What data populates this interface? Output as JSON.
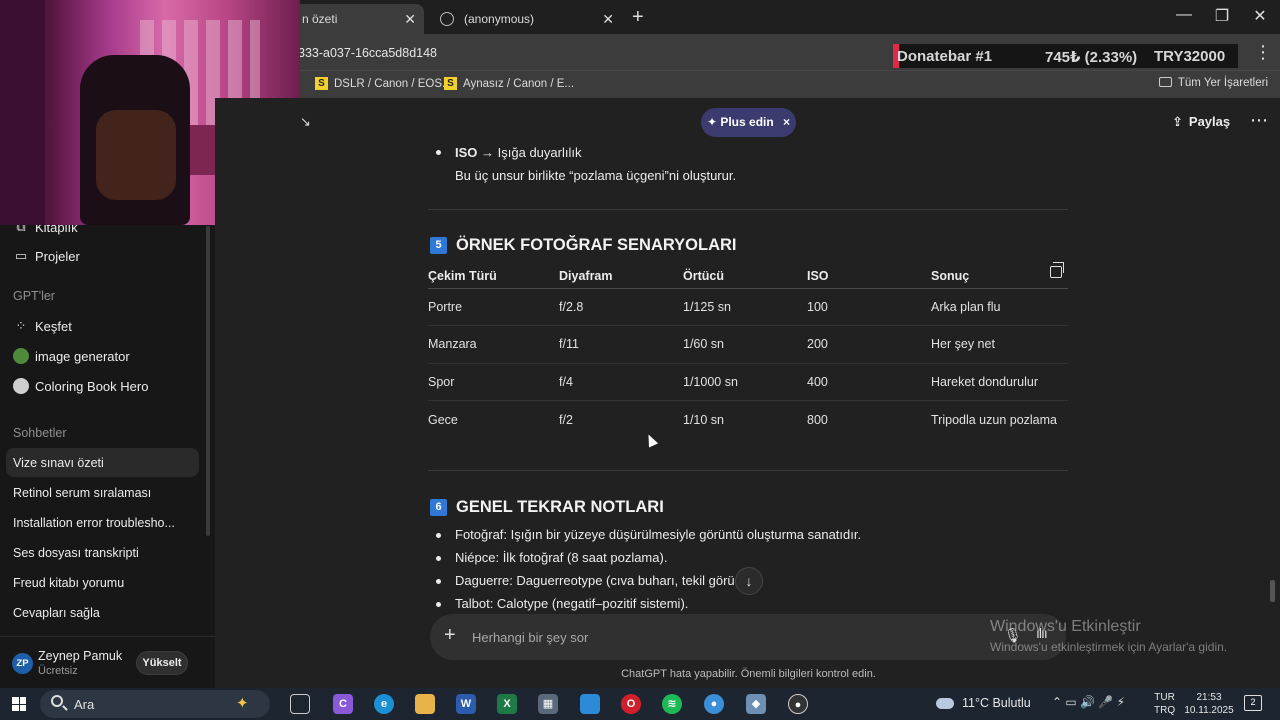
{
  "browser": {
    "tab_active_title": "n özeti",
    "tab_second_title": "(anonymous)",
    "url_fragment": "333-a037-16cca5d8d148",
    "donatebar": {
      "name": "Donatebar #1",
      "amount": "745₺ (2.33%)",
      "goal": "TRY32000"
    },
    "bookmarks": [
      {
        "label": "DSLR / Canon / EOS..."
      },
      {
        "label": "Aynasız / Canon / E..."
      }
    ],
    "all_bookmarks": "Tüm Yer İşaretleri"
  },
  "sidebar": {
    "top_items": [
      {
        "label": "Kitaplık"
      },
      {
        "label": "Projeler"
      }
    ],
    "gpts_header": "GPT'ler",
    "gpts": [
      {
        "label": "Keşfet"
      },
      {
        "label": "image generator"
      },
      {
        "label": "Coloring Book Hero"
      }
    ],
    "chats_header": "Sohbetler",
    "chats": [
      {
        "label": "Vize sınavı özeti"
      },
      {
        "label": "Retinol serum sıralaması"
      },
      {
        "label": "Installation error troublesho..."
      },
      {
        "label": "Ses dosyası transkripti"
      },
      {
        "label": "Freud kitabı yorumu"
      },
      {
        "label": "Cevapları sağla"
      }
    ],
    "user": {
      "initials": "ZP",
      "name": "Zeynep Pamuk",
      "plan": "Ücretsiz",
      "upgrade": "Yükselt"
    }
  },
  "header": {
    "plus_pill": "✦ Plus edin",
    "plus_close": "×",
    "share": "Paylaş"
  },
  "content": {
    "iso_bold": "ISO",
    "iso_rest": "→ Işığa duyarlılık",
    "triangle_note": "Bu üç unsur birlikte “pozlama üçgeni”ni oluşturur.",
    "section5": {
      "num": "5",
      "title": "ÖRNEK FOTOĞRAF SENARYOLARI"
    },
    "table": {
      "headers": [
        "Çekim Türü",
        "Diyafram",
        "Örtücü",
        "ISO",
        "Sonuç"
      ],
      "rows": [
        [
          "Portre",
          "f/2.8",
          "1/125 sn",
          "100",
          "Arka plan flu"
        ],
        [
          "Manzara",
          "f/11",
          "1/60 sn",
          "200",
          "Her şey net"
        ],
        [
          "Spor",
          "f/4",
          "1/1000 sn",
          "400",
          "Hareket dondurulur"
        ],
        [
          "Gece",
          "f/2",
          "1/10 sn",
          "800",
          "Tripodla uzun pozlama"
        ]
      ]
    },
    "section6": {
      "num": "6",
      "title": "GENEL TEKRAR NOTLARI"
    },
    "notes": [
      "Fotoğraf: Işığın bir yüzeye düşürülmesiyle görüntü oluşturma sanatıdır.",
      "Niépce: İlk fotoğraf (8 saat pozlama).",
      "Daguerre: Daguerreotype (cıva buharı, tekil görü     ).",
      "Talbot: Calotype (negatif–pozitif sistemi)."
    ]
  },
  "composer": {
    "placeholder": "Herhangi bir şey sor",
    "disclaimer": "ChatGPT hata yapabilir. Önemli bilgileri kontrol edin."
  },
  "windows_activation": {
    "line1": "Windows'u Etkinleştir",
    "line2": "Windows'u etkinleştirmek için Ayarlar'a gidin."
  },
  "taskbar": {
    "search_label": "Ara",
    "weather": "11°C  Bulutlu",
    "lang_top": "TUR",
    "lang_bottom": "TRQ",
    "time": "21:53",
    "date": "10.11.2025",
    "notifications": "2",
    "apps": [
      "task-view",
      "copilot",
      "edge",
      "file-explorer",
      "word",
      "excel",
      "calculator",
      "store",
      "opera",
      "spotify",
      "chrome",
      "app-extra",
      "obs"
    ]
  }
}
